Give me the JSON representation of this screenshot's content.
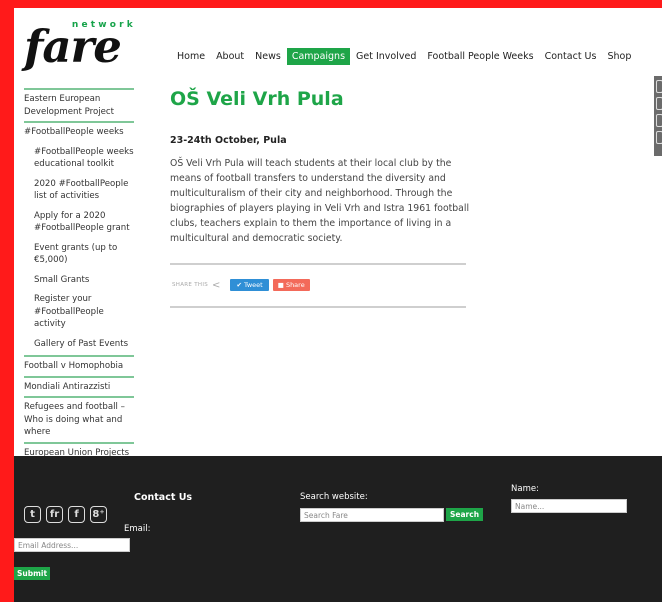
{
  "logo": {
    "network": "network",
    "wordmark": "fare"
  },
  "nav": {
    "items": [
      {
        "label": "Home"
      },
      {
        "label": "About"
      },
      {
        "label": "News"
      },
      {
        "label": "Campaigns"
      },
      {
        "label": "Get Involved"
      },
      {
        "label": "Football People Weeks"
      },
      {
        "label": "Contact Us"
      },
      {
        "label": "Shop"
      }
    ],
    "active": "Campaigns"
  },
  "sidebar": {
    "items": [
      {
        "label": "Eastern European Development Project",
        "sub": false
      },
      {
        "label": "#FootballPeople weeks",
        "sub": false
      },
      {
        "label": "#FootballPeople weeks educational toolkit",
        "sub": true
      },
      {
        "label": "2020 #FootballPeople list of activities",
        "sub": true
      },
      {
        "label": "Apply for a 2020 #FootballPeople grant",
        "sub": true
      },
      {
        "label": "Event grants (up to €5,000)",
        "sub": true
      },
      {
        "label": "Small Grants",
        "sub": true
      },
      {
        "label": "Register your #FootballPeople activity",
        "sub": true
      },
      {
        "label": "Gallery of Past Events",
        "sub": true
      },
      {
        "label": "Football v Homophobia",
        "sub": false
      },
      {
        "label": "Mondiali Antirazzisti",
        "sub": false
      },
      {
        "label": "Refugees and football – Who is doing what and where",
        "sub": false
      },
      {
        "label": "European Union Projects",
        "sub": false
      }
    ]
  },
  "article": {
    "title": "OŠ Veli Vrh Pula",
    "date": "23-24th October, Pula",
    "body": "OŠ Veli Vrh Pula will teach students at their local club by the means of football transfers to understand the diversity and multiculturalism of their city and neighborhood. Through the biographies of players playing in Veli Vrh and Istra 1961 football clubs, teachers explain to them the importance of living in a multicultural and democratic society.",
    "share_label": "SHARE THIS",
    "tweet_label": "Tweet",
    "share_button_label": "Share"
  },
  "footer": {
    "contact_title": "Contact Us",
    "email_label": "Email:",
    "email_placeholder": "Email Address...",
    "submit_label": "Submit",
    "search_label": "Search website:",
    "search_placeholder": "Search Fare",
    "search_button": "Search",
    "name_label": "Name:",
    "name_placeholder": "Name...",
    "socials": [
      {
        "icon": "twitter-icon",
        "glyph": "t"
      },
      {
        "icon": "fare-icon",
        "glyph": "fr"
      },
      {
        "icon": "facebook-icon",
        "glyph": "f"
      },
      {
        "icon": "google-plus-icon",
        "glyph": "8⁺"
      }
    ]
  },
  "colors": {
    "accent": "#1ea548",
    "frame": "#ff1a1a",
    "footer": "#1f1f1f"
  }
}
